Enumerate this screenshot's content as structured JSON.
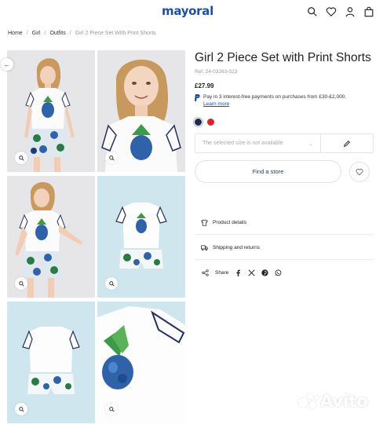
{
  "header": {
    "logo": "mayoral",
    "icons": [
      "search-icon",
      "heart-icon",
      "user-icon",
      "bag-icon"
    ]
  },
  "breadcrumb": {
    "items": [
      "Home",
      "Girl",
      "Outfits"
    ],
    "separator": "/",
    "current": "Girl 2 Piece Set With Print Shorts"
  },
  "gallery": {
    "images": [
      "girl-front-full-photo",
      "girl-closeup-smile-photo",
      "girl-standing-pose-photo",
      "outfit-flatlay-blue-bg",
      "outfit-flatlay-back-blue-bg",
      "shirt-pineapple-detail-blue-bg"
    ],
    "zoom_icon": "zoom-icon",
    "prev_icon": "arrow-left-icon"
  },
  "product": {
    "title": "Girl 2 Piece Set with Print Shorts",
    "ref": "Ref. 24-03263-023",
    "price": "£27.99",
    "paypal_text": "Pay in 3 interest-free payments on purchases from £30-£2,000.",
    "paypal_link": "Learn more",
    "colors": [
      "#1e2a55",
      "#d8262b"
    ],
    "size_placeholder": "The selected size is not available",
    "find_store": "Find a store"
  },
  "accordion": {
    "details": "Product details",
    "shipping": "Shipping and returns"
  },
  "share": {
    "label": "Share",
    "networks": [
      "facebook-icon",
      "x-icon",
      "pinterest-icon",
      "whatsapp-icon"
    ]
  },
  "watermark": "Avito",
  "colors": {
    "brand": "#1f4f9c",
    "photo_bg_grey": "#e6e6e8",
    "photo_bg_blue": "#cfe6ef",
    "link": "#1a4fa3"
  }
}
